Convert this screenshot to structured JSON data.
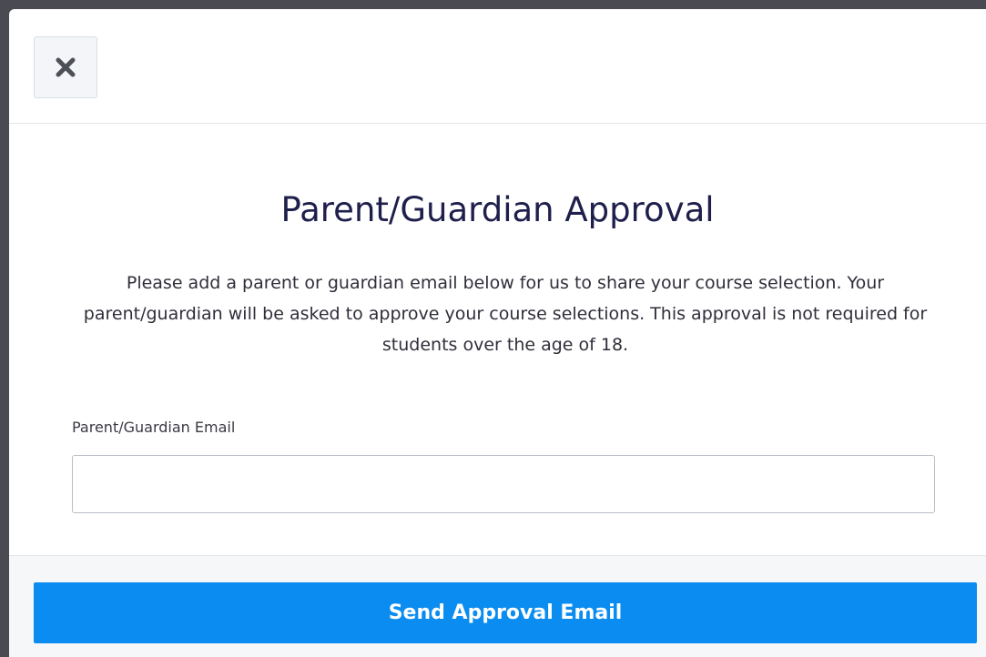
{
  "modal": {
    "close_icon": "close-icon",
    "title": "Parent/Guardian Approval",
    "description": "Please add a parent or guardian email below for us to share your course selection. Your parent/guardian will be asked to approve your course selections. This approval is not required for students over the age of 18.",
    "email_label": "Parent/Guardian Email",
    "email_value": "",
    "email_placeholder": "",
    "send_button_label": "Send Approval Email"
  },
  "colors": {
    "accent": "#0a8cf0",
    "title": "#1e1f4b",
    "backdrop": "#4a4a52"
  }
}
